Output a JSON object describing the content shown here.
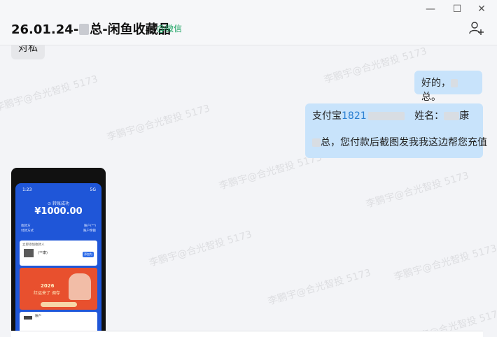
{
  "window": {
    "title_prefix": "26.01.24-",
    "title_suffix": "总-闲鱼收藏品",
    "wechat_tag": "@微信",
    "minimize_glyph": "—",
    "maximize_glyph": "☐",
    "close_glyph": "✕"
  },
  "messages": {
    "incoming_top": "对私",
    "outgoing_ok_prefix": "好的，",
    "outgoing_ok_suffix": "总。",
    "outgoing_pay": {
      "alipay_label": "支付宝",
      "alipay_number": "1821",
      "name_label": "姓名：",
      "name_char": "康",
      "line2_suffix": "总，您付款后截图发我我这边帮您充值"
    }
  },
  "screenshot": {
    "status_time": "1:23",
    "status_battery": "5G",
    "success_text": "⊙ 转账成功",
    "amount": "¥1000.00",
    "row1_left": "收款方",
    "row1_right": "账户(**)",
    "row2_left": "付款方式",
    "row2_right": "账户余额",
    "card_title": "立即添加收款人",
    "card_name": "(**康)",
    "card_button": "添加为",
    "ad_year": "2026",
    "ad_sub": "红运来了 调存",
    "bottom_title": "账户"
  },
  "watermark": {
    "text": "李鹏宇@合光智投 5173"
  }
}
